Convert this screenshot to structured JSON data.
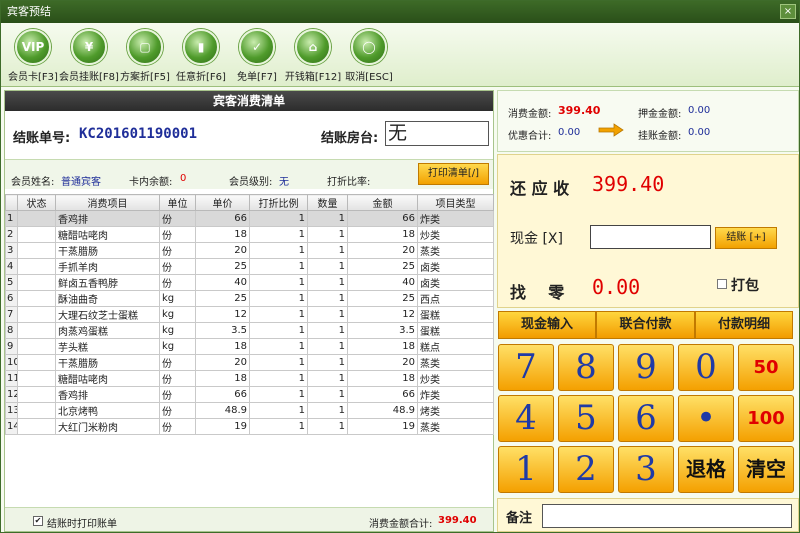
{
  "window": {
    "title": "宾客预结",
    "close_glyph": "×"
  },
  "toolbar": [
    {
      "label": "会员卡[F3]",
      "glyph": "VIP",
      "icon": "vip-icon"
    },
    {
      "label": "会员挂账[F8]",
      "glyph": "¥",
      "icon": "member-charge-icon"
    },
    {
      "label": "方案折[F5]",
      "glyph": "▢",
      "icon": "plan-discount-icon"
    },
    {
      "label": "任意折[F6]",
      "glyph": "▮",
      "icon": "free-discount-icon"
    },
    {
      "label": "免单[F7]",
      "glyph": "✓",
      "icon": "free-order-icon"
    },
    {
      "label": "开钱箱[F12]",
      "glyph": "⌂",
      "icon": "cash-drawer-icon"
    },
    {
      "label": "取消[ESC]",
      "glyph": "◯",
      "icon": "cancel-icon"
    }
  ],
  "bill": {
    "header": "宾客消费清单",
    "bill_no_label": "结账单号:",
    "bill_no": "KC201601190001",
    "room_label": "结账房台:",
    "room": "无",
    "member_name_label": "会员姓名:",
    "member_name": "普通宾客",
    "card_balance_label": "卡内余额:",
    "card_balance": "0",
    "member_level_label": "会员级别:",
    "member_level": "无",
    "discount_rate_label": "打折比率:",
    "discount_rate": "",
    "print_button": "打印清单[/]"
  },
  "table": {
    "columns": [
      "",
      "状态",
      "消费项目",
      "单位",
      "单价",
      "打折比例",
      "数量",
      "金额",
      "项目类型"
    ],
    "rows": [
      [
        "1",
        "",
        "香鸡排",
        "份",
        "66",
        "1",
        "1",
        "66",
        "炸类"
      ],
      [
        "2",
        "",
        "糖醋咕咾肉",
        "份",
        "18",
        "1",
        "1",
        "18",
        "炒类"
      ],
      [
        "3",
        "",
        "干蒸腊肠",
        "份",
        "20",
        "1",
        "1",
        "20",
        "蒸类"
      ],
      [
        "4",
        "",
        "手抓羊肉",
        "份",
        "25",
        "1",
        "1",
        "25",
        "卤类"
      ],
      [
        "5",
        "",
        "鲜卤五香鸭脖",
        "份",
        "40",
        "1",
        "1",
        "40",
        "卤类"
      ],
      [
        "6",
        "",
        "酥油曲奇",
        "kg",
        "25",
        "1",
        "1",
        "25",
        "西点"
      ],
      [
        "7",
        "",
        "大理石纹芝士蛋糕",
        "kg",
        "12",
        "1",
        "1",
        "12",
        "蛋糕"
      ],
      [
        "8",
        "",
        "肉蒸鸡蛋糕",
        "kg",
        "3.5",
        "1",
        "1",
        "3.5",
        "蛋糕"
      ],
      [
        "9",
        "",
        "芋头糕",
        "kg",
        "18",
        "1",
        "1",
        "18",
        "糕点"
      ],
      [
        "10",
        "",
        "干蒸腊肠",
        "份",
        "20",
        "1",
        "1",
        "20",
        "蒸类"
      ],
      [
        "11",
        "",
        "糖醋咕咾肉",
        "份",
        "18",
        "1",
        "1",
        "18",
        "炒类"
      ],
      [
        "12",
        "",
        "香鸡排",
        "份",
        "66",
        "1",
        "1",
        "66",
        "炸类"
      ],
      [
        "13",
        "",
        "北京烤鸭",
        "份",
        "48.9",
        "1",
        "1",
        "48.9",
        "烤类"
      ],
      [
        "14",
        "",
        "大红门米粉肉",
        "份",
        "19",
        "1",
        "1",
        "19",
        "蒸类"
      ]
    ]
  },
  "footer": {
    "print_on_checkout": "结账时打印账单",
    "print_on_checkout_checked": true,
    "total_label": "消费金额合计:",
    "total": "399.40"
  },
  "summary": {
    "consume_label": "消费金额:",
    "consume": "399.40",
    "deposit_label": "押金金额:",
    "deposit": "0.00",
    "discount_label": "优惠合计:",
    "discount": "0.00",
    "charge_label": "挂账金额:",
    "charge": "0.00"
  },
  "payment": {
    "due_label": "还 应 收",
    "due": "399.40",
    "cash_label": "现金 [X]",
    "cash_value": "",
    "settle_button": "结账 [+]",
    "change_label": "找    零",
    "change": "0.00",
    "pack_label": "打包",
    "pack_checked": false,
    "tabs": [
      "现金输入",
      "联合付款",
      "付款明细"
    ]
  },
  "keypad": [
    [
      "7",
      "8",
      "9",
      "0",
      "50"
    ],
    [
      "4",
      "5",
      "6",
      "•",
      "100"
    ],
    [
      "1",
      "2",
      "3",
      "退格",
      "清空"
    ]
  ],
  "note": {
    "label": "备注",
    "value": ""
  },
  "colors": {
    "title_bar": "#2f5a1d",
    "accent_orange": "#f4a000",
    "amount_red": "#e00000",
    "bill_no_blue": "#1f2e99"
  }
}
